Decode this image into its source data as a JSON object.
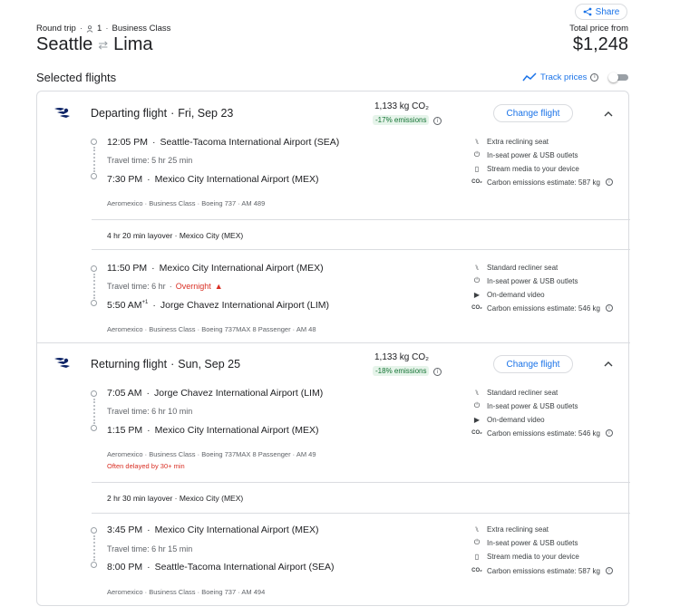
{
  "header": {
    "share_label": "Share",
    "trip_type": "Round trip",
    "passengers": "1",
    "cabin": "Business Class",
    "origin": "Seattle",
    "destination": "Lima",
    "price_label": "Total price from",
    "price": "$1,248"
  },
  "selected": {
    "title": "Selected flights",
    "track_label": "Track prices"
  },
  "departing": {
    "title": "Departing flight",
    "date": "Fri, Sep 23",
    "co2": "1,133 kg CO₂",
    "co2_badge": "-17% emissions",
    "change_label": "Change flight",
    "leg1": {
      "dep_time": "12:05 PM",
      "dep_airport": "Seattle-Tacoma International Airport (SEA)",
      "travel_time": "Travel time: 5 hr 25 min",
      "arr_time": "7:30 PM",
      "arr_airport": "Mexico City International Airport (MEX)",
      "details": "Aeromexico · Business Class · Boeing 737 · AM 489",
      "amenities": [
        "Extra reclining seat",
        "In-seat power & USB outlets",
        "Stream media to your device",
        "Carbon emissions estimate: 587 kg"
      ]
    },
    "layover": "4 hr 20 min layover · Mexico City (MEX)",
    "leg2": {
      "dep_time": "11:50 PM",
      "dep_airport": "Mexico City International Airport (MEX)",
      "travel_time": "Travel time: 6 hr",
      "overnight": "Overnight",
      "arr_time": "5:50 AM",
      "arr_sup": "+1",
      "arr_airport": "Jorge Chavez International Airport (LIM)",
      "details": "Aeromexico · Business Class · Boeing 737MAX 8 Passenger · AM 48",
      "amenities": [
        "Standard recliner seat",
        "In-seat power & USB outlets",
        "On-demand video",
        "Carbon emissions estimate: 546 kg"
      ]
    }
  },
  "returning": {
    "title": "Returning flight",
    "date": "Sun, Sep 25",
    "co2": "1,133 kg CO₂",
    "co2_badge": "-18% emissions",
    "change_label": "Change flight",
    "leg1": {
      "dep_time": "7:05 AM",
      "dep_airport": "Jorge Chavez International Airport (LIM)",
      "travel_time": "Travel time: 6 hr 10 min",
      "arr_time": "1:15 PM",
      "arr_airport": "Mexico City International Airport (MEX)",
      "details": "Aeromexico · Business Class · Boeing 737MAX 8 Passenger · AM 49",
      "delay": "Often delayed by 30+ min",
      "amenities": [
        "Standard recliner seat",
        "In-seat power & USB outlets",
        "On-demand video",
        "Carbon emissions estimate: 546 kg"
      ]
    },
    "layover": "2 hr 30 min layover · Mexico City (MEX)",
    "leg2": {
      "dep_time": "3:45 PM",
      "dep_airport": "Mexico City International Airport (MEX)",
      "travel_time": "Travel time: 6 hr 15 min",
      "arr_time": "8:00 PM",
      "arr_airport": "Seattle-Tacoma International Airport (SEA)",
      "details": "Aeromexico · Business Class · Boeing 737 · AM 494",
      "amenities": [
        "Extra reclining seat",
        "In-seat power & USB outlets",
        "Stream media to your device",
        "Carbon emissions estimate: 587 kg"
      ]
    }
  },
  "colors": {
    "accent": "#1a73e8",
    "green_badge_bg": "#e6f4ea",
    "green_badge_text": "#137333",
    "warning": "#d93025",
    "border": "#dadce0"
  }
}
